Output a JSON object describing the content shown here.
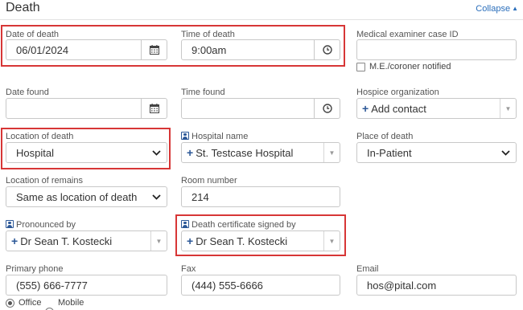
{
  "section": {
    "title": "Death",
    "collapse_label": "Collapse"
  },
  "date_of_death": {
    "label": "Date of death",
    "value": "06/01/2024",
    "icon": "calendar-icon"
  },
  "time_of_death": {
    "label": "Time of death",
    "value": "9:00am",
    "icon": "clock-icon"
  },
  "medical_examiner": {
    "label": "Medical examiner case ID",
    "value": "",
    "checkbox_label": "M.E./coroner notified"
  },
  "date_found": {
    "label": "Date found",
    "value": ""
  },
  "time_found": {
    "label": "Time found",
    "value": ""
  },
  "hospice": {
    "label": "Hospice organization",
    "value": "Add contact"
  },
  "location_of_death": {
    "label": "Location of death",
    "value": "Hospital"
  },
  "hospital_name": {
    "label": "Hospital name",
    "value": "St. Testcase Hospital"
  },
  "place_of_death": {
    "label": "Place of death",
    "value": "In-Patient"
  },
  "location_of_remains": {
    "label": "Location of remains",
    "value": "Same as location of death"
  },
  "room_number": {
    "label": "Room number",
    "value": "214"
  },
  "pronounced_by": {
    "label": "Pronounced by",
    "value": "Dr Sean T. Kostecki"
  },
  "certificate_signed_by": {
    "label": "Death certificate signed by",
    "value": "Dr Sean T. Kostecki"
  },
  "primary_phone": {
    "label": "Primary phone",
    "value": "(555) 666-7777",
    "options": [
      "Office",
      "Mobile"
    ],
    "selected": "Office"
  },
  "fax": {
    "label": "Fax",
    "value": "(444) 555-6666"
  },
  "email": {
    "label": "Email",
    "value": "hos@pital.com"
  },
  "colors": {
    "highlight": "#d73636",
    "link": "#2a6ebb",
    "accent": "#2b5797",
    "border": "#c8c8c8"
  }
}
